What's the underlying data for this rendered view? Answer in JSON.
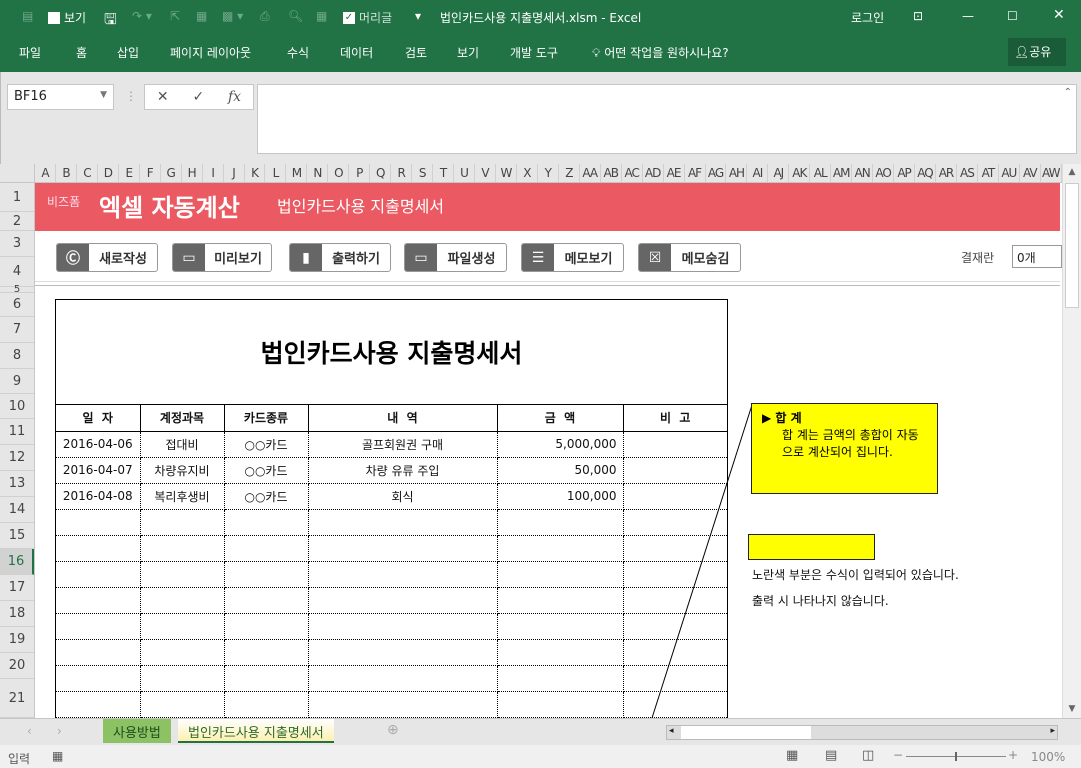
{
  "titlebar": {
    "qa_view": "보기",
    "qa_header": "머리글",
    "title": "법인카드사용 지출명세서.xlsm - Excel",
    "login": "로그인"
  },
  "ribbon": {
    "tabs": [
      "파일",
      "홈",
      "삽입",
      "페이지 레이아웃",
      "수식",
      "데이터",
      "검토",
      "보기",
      "개발 도구"
    ],
    "tell_me": "어떤 작업을 원하시나요?",
    "share": "공유"
  },
  "formula_bar": {
    "name_box": "BF16",
    "formula": ""
  },
  "columns": [
    "A",
    "B",
    "C",
    "D",
    "E",
    "F",
    "G",
    "H",
    "I",
    "J",
    "K",
    "L",
    "M",
    "N",
    "O",
    "P",
    "Q",
    "R",
    "S",
    "T",
    "U",
    "V",
    "W",
    "X",
    "Y",
    "Z",
    "AA",
    "AB",
    "AC",
    "AD",
    "AE",
    "AF",
    "AG",
    "AH",
    "AI",
    "AJ",
    "AK",
    "AL",
    "AM",
    "AN",
    "AO",
    "AP",
    "AQ",
    "AR",
    "AS",
    "AT",
    "AU",
    "AV",
    "AW"
  ],
  "rows": [
    "1",
    "2",
    "3",
    "4",
    "5",
    "6",
    "7",
    "8",
    "9",
    "10",
    "11",
    "12",
    "13",
    "14",
    "15",
    "16",
    "17",
    "18",
    "19",
    "20",
    "21"
  ],
  "selected_row": "16",
  "banner": {
    "brand": "비즈폼",
    "app": "엑셀 자동계산",
    "subtitle": "법인카드사용 지출명세서"
  },
  "buttons": [
    "새로작성",
    "미리보기",
    "출력하기",
    "파일생성",
    "메모보기",
    "메모숨김"
  ],
  "approval": {
    "label": "결재란",
    "value": "0개"
  },
  "document": {
    "title": "법인카드사용 지출명세서",
    "headers": [
      "일  자",
      "계정과목",
      "카드종류",
      "내  역",
      "금  액",
      "비  고"
    ],
    "rows": [
      [
        "2016-04-06",
        "접대비",
        "○○카드",
        "골프회원권 구매",
        "5,000,000",
        ""
      ],
      [
        "2016-04-07",
        "차량유지비",
        "○○카드",
        "차량 유류 주입",
        "50,000",
        ""
      ],
      [
        "2016-04-08",
        "복리후생비",
        "○○카드",
        "회식",
        "100,000",
        ""
      ]
    ],
    "empty_rows": 8
  },
  "memo": {
    "title": "▶ 합  계",
    "body": "합  계는 금액의 총합이 자동으로 계산되어 집니다."
  },
  "notes": [
    "노란색 부분은 수식이 입력되어 있습니다.",
    "출력 시 나타나지 않습니다."
  ],
  "sheets": [
    "사용방법",
    "법인카드사용 지출명세서"
  ],
  "status": {
    "mode": "입력",
    "zoom": "100%"
  },
  "colors": {
    "excel_green": "#217346",
    "banner_red": "#eb5a62",
    "memo_yellow": "#ffff00"
  }
}
